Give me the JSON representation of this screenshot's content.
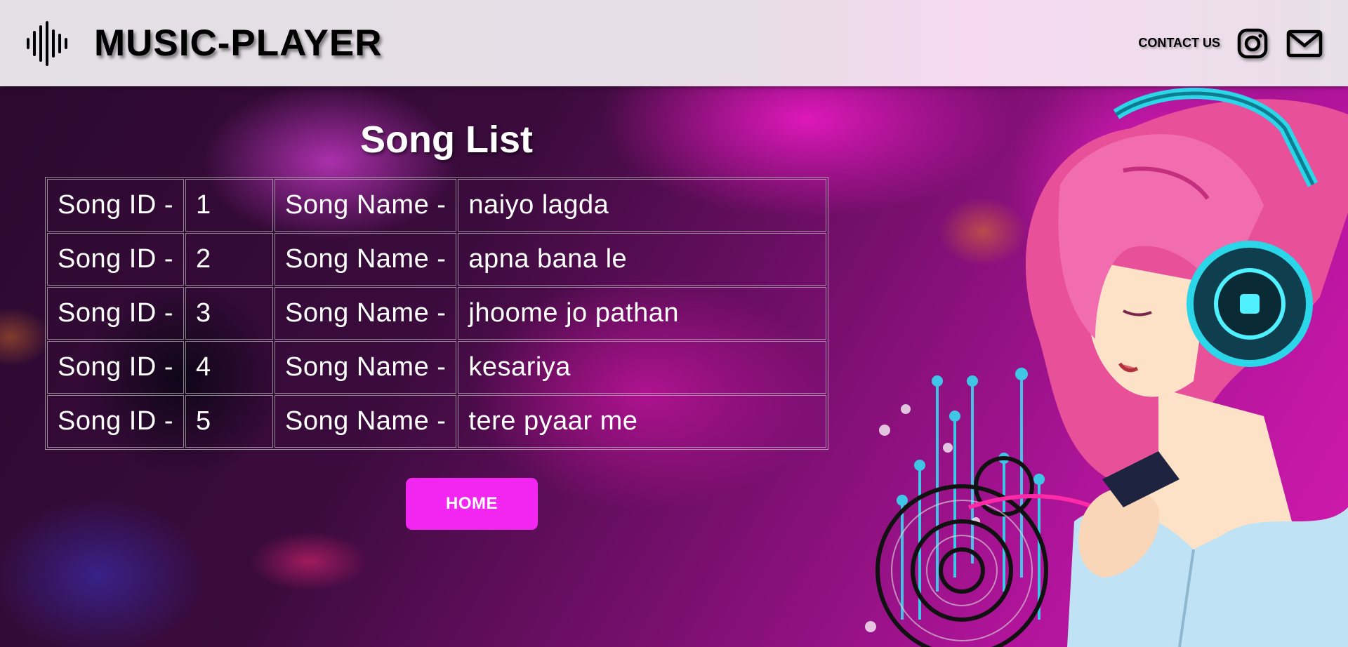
{
  "header": {
    "brand": "MUSIC-PLAYER",
    "contact_label": "CONTACT US",
    "icons": [
      "waveform-icon",
      "instagram-icon",
      "mail-icon"
    ]
  },
  "main": {
    "title": "Song List",
    "rows": [
      {
        "id_label": "Song ID -",
        "id": "1",
        "name_label": "Song Name -",
        "name": "naiyo lagda"
      },
      {
        "id_label": "Song ID -",
        "id": "2",
        "name_label": "Song Name -",
        "name": "apna bana le"
      },
      {
        "id_label": "Song ID -",
        "id": "3",
        "name_label": "Song Name -",
        "name": "jhoome jo pathan"
      },
      {
        "id_label": "Song ID -",
        "id": "4",
        "name_label": "Song Name -",
        "name": "kesariya"
      },
      {
        "id_label": "Song ID -",
        "id": "5",
        "name_label": "Song Name -",
        "name": "tere pyaar me"
      }
    ],
    "home_button": "HOME"
  },
  "colors": {
    "accent_button": "#f226f0",
    "header_bg": "#e3e0e4",
    "text_light": "#ffffff"
  }
}
